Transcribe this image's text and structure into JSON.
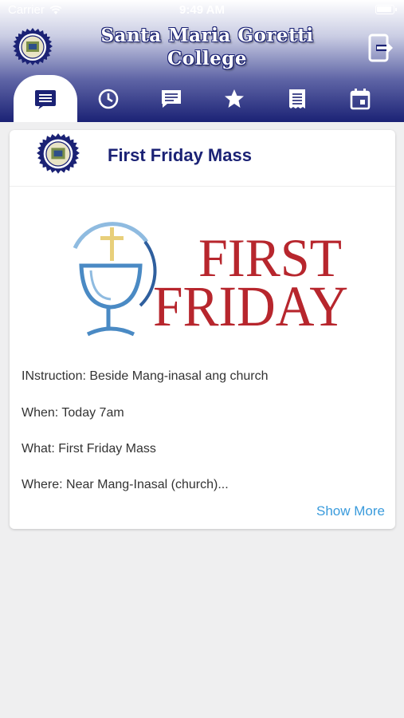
{
  "status_bar": {
    "carrier": "Carrier",
    "time": "9:49 AM"
  },
  "header": {
    "college_name_line1": "Santa Maria Goretti",
    "college_name_line2": "College",
    "logo_icon": "college-seal-icon",
    "logout_icon": "logout-icon"
  },
  "tabs": [
    {
      "icon": "announcements-icon",
      "active": true
    },
    {
      "icon": "clock-icon",
      "active": false
    },
    {
      "icon": "message-icon",
      "active": false
    },
    {
      "icon": "star-icon",
      "active": false
    },
    {
      "icon": "receipt-icon",
      "active": false
    },
    {
      "icon": "calendar-icon",
      "active": false
    }
  ],
  "post": {
    "title": "First Friday Mass",
    "banner": {
      "line1": "FIRST",
      "line2": "FRIDAY"
    },
    "instruction": "INstruction: Beside Mang-inasal ang church",
    "when": "When: Today 7am",
    "what": "What: First Friday Mass",
    "where": "Where: Near Mang-Inasal (church)...",
    "show_more_label": "Show More"
  },
  "colors": {
    "brand_navy": "#1b2275",
    "banner_red": "#b7262d",
    "banner_blue": "#4a8ac4",
    "link_blue": "#3a9bdc",
    "page_bg": "#efeff0"
  }
}
